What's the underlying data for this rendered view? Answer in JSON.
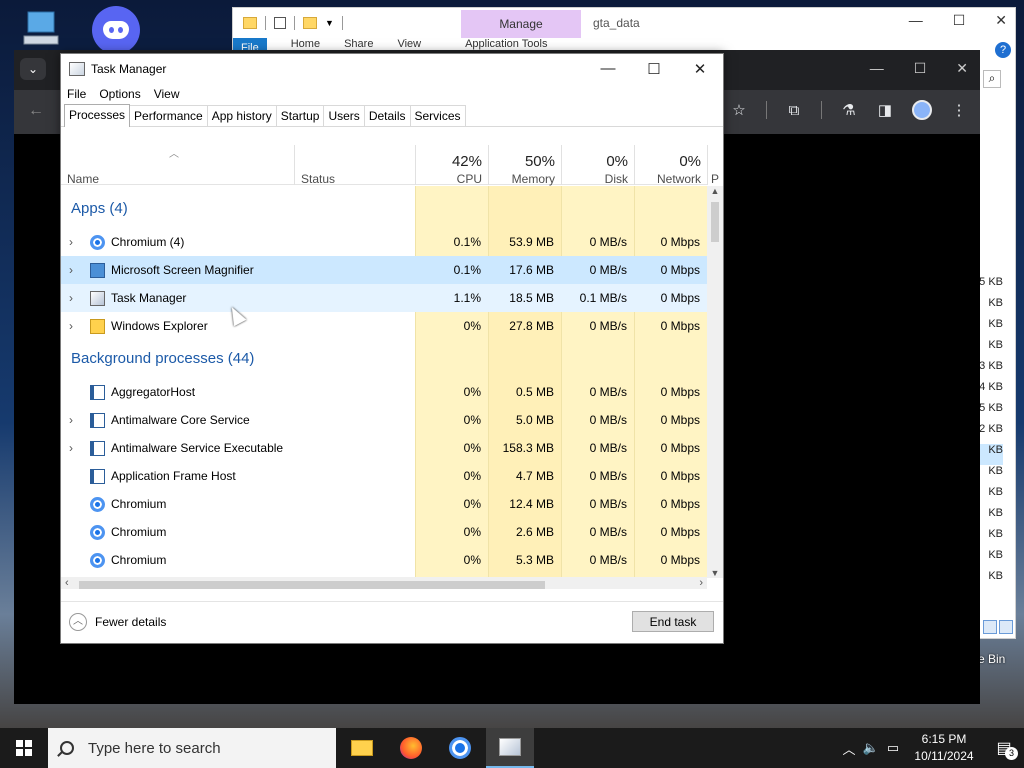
{
  "desktop": {
    "recycle_bin_label": "e Bin"
  },
  "explorer": {
    "manage_tab": "Manage",
    "path": "gta_data",
    "ribbon_tabs": [
      "File",
      "Home",
      "Share",
      "View",
      "Application Tools"
    ],
    "right_sizes": [
      "5 KB",
      "KB",
      "KB",
      "KB",
      "3 KB",
      "4 KB",
      "5 KB",
      "2 KB",
      "KB",
      "KB",
      "KB",
      "KB",
      "KB",
      "KB",
      "KB"
    ]
  },
  "taskmanager": {
    "title": "Task Manager",
    "menu": [
      "File",
      "Options",
      "View"
    ],
    "tabs": [
      "Processes",
      "Performance",
      "App history",
      "Startup",
      "Users",
      "Details",
      "Services"
    ],
    "active_tab": "Processes",
    "columns": {
      "name": "Name",
      "status": "Status",
      "cpu": {
        "pct": "42%",
        "label": "CPU"
      },
      "memory": {
        "pct": "50%",
        "label": "Memory"
      },
      "disk": {
        "pct": "0%",
        "label": "Disk"
      },
      "network": {
        "pct": "0%",
        "label": "Network"
      },
      "power": "P"
    },
    "groups": {
      "apps": "Apps (4)",
      "background": "Background processes (44)"
    },
    "apps": [
      {
        "name": "Chromium (4)",
        "cpu": "0.1%",
        "memory": "53.9 MB",
        "disk": "0 MB/s",
        "network": "0 Mbps"
      },
      {
        "name": "Microsoft Screen Magnifier",
        "cpu": "0.1%",
        "memory": "17.6 MB",
        "disk": "0 MB/s",
        "network": "0 Mbps"
      },
      {
        "name": "Task Manager",
        "cpu": "1.1%",
        "memory": "18.5 MB",
        "disk": "0.1 MB/s",
        "network": "0 Mbps"
      },
      {
        "name": "Windows Explorer",
        "cpu": "0%",
        "memory": "27.8 MB",
        "disk": "0 MB/s",
        "network": "0 Mbps"
      }
    ],
    "background": [
      {
        "name": "AggregatorHost",
        "cpu": "0%",
        "memory": "0.5 MB",
        "disk": "0 MB/s",
        "network": "0 Mbps"
      },
      {
        "name": "Antimalware Core Service",
        "cpu": "0%",
        "memory": "5.0 MB",
        "disk": "0 MB/s",
        "network": "0 Mbps"
      },
      {
        "name": "Antimalware Service Executable",
        "cpu": "0%",
        "memory": "158.3 MB",
        "disk": "0 MB/s",
        "network": "0 Mbps"
      },
      {
        "name": "Application Frame Host",
        "cpu": "0%",
        "memory": "4.7 MB",
        "disk": "0 MB/s",
        "network": "0 Mbps"
      },
      {
        "name": "Chromium",
        "cpu": "0%",
        "memory": "12.4 MB",
        "disk": "0 MB/s",
        "network": "0 Mbps"
      },
      {
        "name": "Chromium",
        "cpu": "0%",
        "memory": "2.6 MB",
        "disk": "0 MB/s",
        "network": "0 Mbps"
      },
      {
        "name": "Chromium",
        "cpu": "0%",
        "memory": "5.3 MB",
        "disk": "0 MB/s",
        "network": "0 Mbps"
      }
    ],
    "footer": {
      "fewer_details": "Fewer details",
      "end_task": "End task"
    }
  },
  "taskbar": {
    "search_placeholder": "Type here to search",
    "time": "6:15 PM",
    "date": "10/11/2024",
    "notification_count": "3"
  }
}
